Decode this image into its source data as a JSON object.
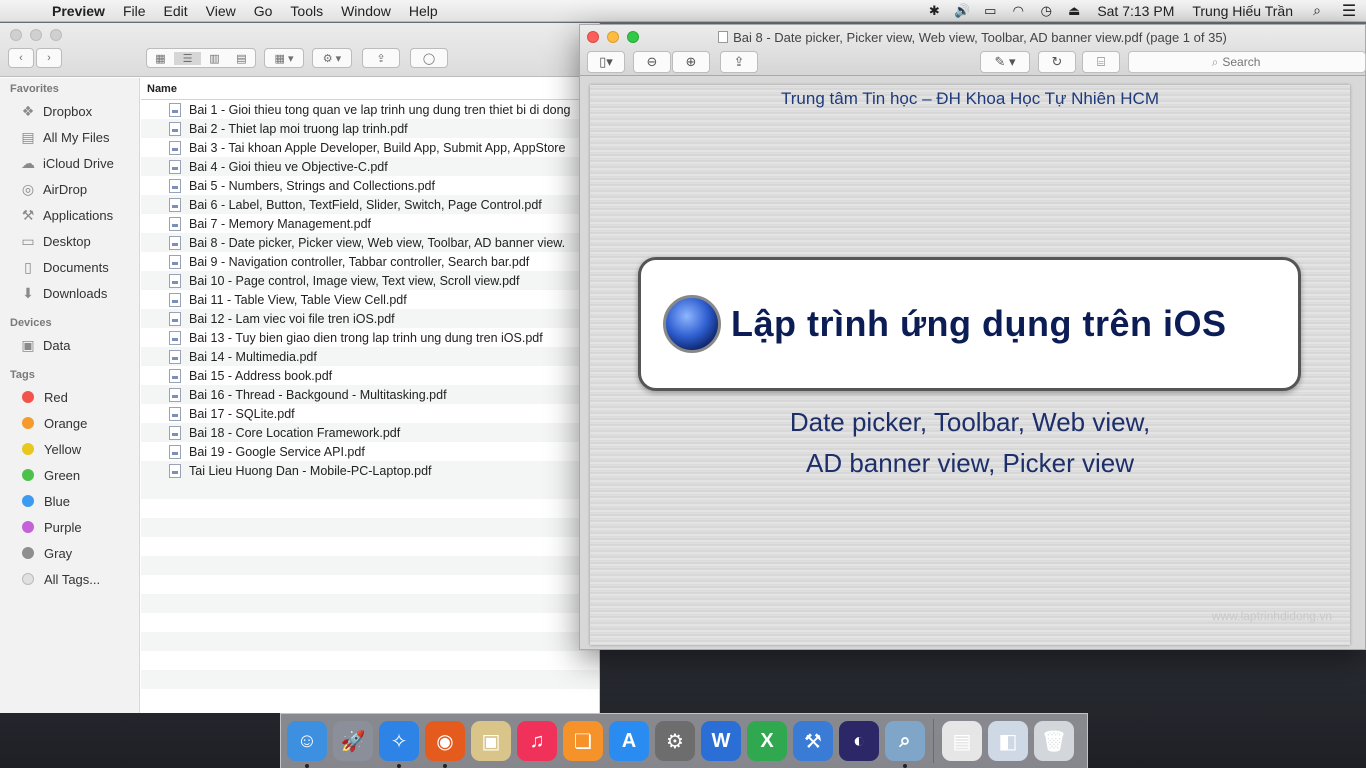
{
  "menubar": {
    "app_name": "Preview",
    "menus": [
      "File",
      "Edit",
      "View",
      "Go",
      "Tools",
      "Window",
      "Help"
    ],
    "clock": "Sat 7:13 PM",
    "user": "Trung Hiếu Trần"
  },
  "finder": {
    "sidebar": {
      "favorites_header": "Favorites",
      "favorites": [
        {
          "label": "Dropbox",
          "icon": "dropbox-icon"
        },
        {
          "label": "All My Files",
          "icon": "all-files-icon"
        },
        {
          "label": "iCloud Drive",
          "icon": "cloud-icon"
        },
        {
          "label": "AirDrop",
          "icon": "airdrop-icon"
        },
        {
          "label": "Applications",
          "icon": "applications-icon"
        },
        {
          "label": "Desktop",
          "icon": "desktop-icon"
        },
        {
          "label": "Documents",
          "icon": "documents-icon"
        },
        {
          "label": "Downloads",
          "icon": "downloads-icon"
        }
      ],
      "devices_header": "Devices",
      "devices": [
        {
          "label": "Data",
          "icon": "disk-icon"
        }
      ],
      "tags_header": "Tags",
      "tags": [
        {
          "label": "Red",
          "color": "#f2544c"
        },
        {
          "label": "Orange",
          "color": "#f59a2c"
        },
        {
          "label": "Yellow",
          "color": "#e8c71e"
        },
        {
          "label": "Green",
          "color": "#4cc24a"
        },
        {
          "label": "Blue",
          "color": "#3b9bf0"
        },
        {
          "label": "Purple",
          "color": "#c562d8"
        },
        {
          "label": "Gray",
          "color": "#8e8e8e"
        },
        {
          "label": "All Tags...",
          "color": "#e0e0e0"
        }
      ]
    },
    "column_header": "Name",
    "files": [
      "Bai 1 - Gioi thieu tong quan ve lap trinh ung dung tren thiet bi di dong",
      "Bai 2 - Thiet lap moi truong lap trinh.pdf",
      "Bai 3 - Tai khoan Apple Developer, Build App, Submit App, AppStore",
      "Bai 4 - Gioi thieu ve Objective-C.pdf",
      "Bai 5 - Numbers, Strings and Collections.pdf",
      "Bai 6 - Label, Button, TextField, Slider, Switch, Page Control.pdf",
      "Bai 7 - Memory Management.pdf",
      "Bai 8 - Date picker, Picker view, Web view, Toolbar, AD banner view.",
      "Bai 9 - Navigation controller, Tabbar controller, Search bar.pdf",
      "Bai 10 - Page control, Image view, Text view, Scroll view.pdf",
      "Bai 11 - Table View, Table View Cell.pdf",
      "Bai 12 - Lam viec voi file tren iOS.pdf",
      "Bai 13 - Tuy bien giao dien trong lap trinh ung dung tren iOS.pdf",
      "Bai 14 - Multimedia.pdf",
      "Bai 15 - Address book.pdf",
      "Bai 16 - Thread - Backgound - Multitasking.pdf",
      "Bai 17 - SQLite.pdf",
      "Bai 18 - Core Location Framework.pdf",
      "Bai 19 - Google Service API.pdf",
      "Tai Lieu Huong Dan - Mobile-PC-Laptop.pdf"
    ]
  },
  "preview": {
    "window_title": "Bai 8 - Date picker, Picker view, Web view, Toolbar, AD banner view.pdf (page 1 of 35)",
    "search_placeholder": "Search",
    "page": {
      "header": "Trung tâm Tin học – ĐH Khoa Học Tự Nhiên HCM",
      "banner_title": "Lập trình ứng dụng trên iOS",
      "subtitle_line1": "Date picker, Toolbar, Web view,",
      "subtitle_line2": "AD banner view, Picker view",
      "watermark": "www.laptrinhdidong.vn"
    }
  },
  "dock": {
    "apps": [
      {
        "name": "finder",
        "color": "#3d8fe0",
        "glyph": "☺",
        "running": true
      },
      {
        "name": "launchpad",
        "color": "#8a8f99",
        "glyph": "🚀",
        "running": false
      },
      {
        "name": "safari",
        "color": "#2d84e6",
        "glyph": "✧",
        "running": true
      },
      {
        "name": "firefox",
        "color": "#e55b1e",
        "glyph": "◉",
        "running": true
      },
      {
        "name": "preview-app",
        "color": "#d9c48a",
        "glyph": "▣",
        "running": false
      },
      {
        "name": "itunes",
        "color": "#f0325a",
        "glyph": "♫",
        "running": false
      },
      {
        "name": "ibooks",
        "color": "#f5922a",
        "glyph": "❏",
        "running": false
      },
      {
        "name": "app-store",
        "color": "#2a8cf0",
        "glyph": "A",
        "running": false
      },
      {
        "name": "system-preferences",
        "color": "#6d6d6d",
        "glyph": "⚙",
        "running": false
      },
      {
        "name": "microsoft-word",
        "color": "#2b6fd6",
        "glyph": "W",
        "running": false
      },
      {
        "name": "microsoft-excel",
        "color": "#2fa84f",
        "glyph": "X",
        "running": false
      },
      {
        "name": "xcode",
        "color": "#3a7bd5",
        "glyph": "⚒",
        "running": false
      },
      {
        "name": "eclipse",
        "color": "#2c2766",
        "glyph": "◐",
        "running": false
      },
      {
        "name": "preview",
        "color": "#7fa6c9",
        "glyph": "⌕",
        "running": true
      }
    ],
    "docs": [
      {
        "name": "document-stack",
        "color": "#e6e6e6",
        "glyph": "▤"
      },
      {
        "name": "downloads-stack",
        "color": "#cfd9e6",
        "glyph": "◧"
      },
      {
        "name": "trash",
        "color": "#d3d6da",
        "glyph": "🗑"
      }
    ]
  }
}
